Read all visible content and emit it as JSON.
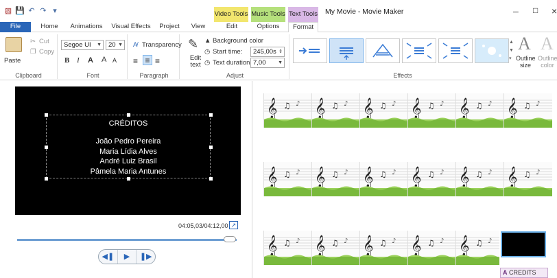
{
  "window": {
    "title": "My Movie - Movie Maker",
    "context_tabs": [
      "Video Tools",
      "Music Tools",
      "Text Tools"
    ]
  },
  "tabs": [
    "File",
    "Home",
    "Animations",
    "Visual Effects",
    "Project",
    "View",
    "Edit",
    "Options",
    "Format"
  ],
  "ribbon": {
    "clipboard": {
      "paste": "Paste",
      "cut": "Cut",
      "copy": "Copy",
      "label": "Clipboard"
    },
    "font": {
      "family": "Segoe UI",
      "size": "20",
      "label": "Font",
      "bold": "B",
      "italic": "I",
      "color": "A",
      "grow": "A",
      "shrink": "A"
    },
    "paragraph": {
      "transparency": "Transparency",
      "label": "Paragraph"
    },
    "adjust": {
      "edit_text": "Edit text",
      "background_color": "Background color",
      "start_time_label": "Start time:",
      "start_time_value": "245,00s",
      "text_duration_label": "Text duration:",
      "text_duration_value": "7,00",
      "label": "Adjust"
    },
    "effects": {
      "label": "Effects"
    },
    "outline": {
      "size": "Outline size",
      "color": "Outline color"
    }
  },
  "preview": {
    "heading": "CRÉDITOS",
    "names": [
      "João Pedro Pereira",
      "Maria Lídia Alves",
      "André Luiz Brasil",
      "Pâmela Maria Antunes"
    ],
    "timecode": "04:05,03/04:12,00",
    "seek_fraction": 0.97
  },
  "storyboard": {
    "caption_chip": "CREDITS"
  },
  "colors": {
    "video_tools": "#f2e66e",
    "music_tools": "#b5e07c",
    "text_tools": "#d9b8e6",
    "file_tab": "#2a66b8",
    "selection": "#cfe3f7"
  }
}
